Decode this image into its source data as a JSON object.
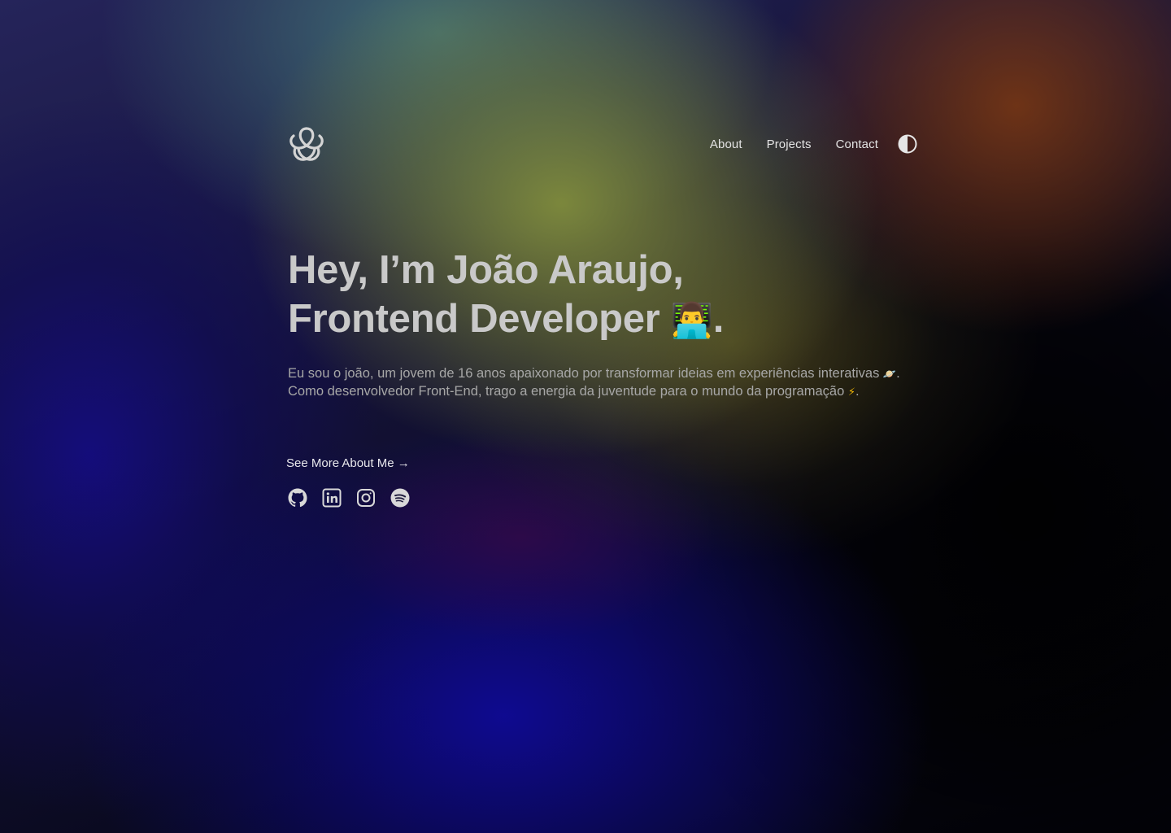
{
  "header": {
    "logo_icon": "trefoil-knot-icon",
    "nav": [
      {
        "label": "About"
      },
      {
        "label": "Projects"
      },
      {
        "label": "Contact"
      }
    ],
    "theme_toggle_icon": "contrast-half-circle-icon"
  },
  "hero": {
    "title_line1": "Hey, I’m João Araujo,",
    "title_line2_text": "Frontend Developer ",
    "title_line2_emoji": "👨‍💻",
    "title_line2_end": ".",
    "intro_part1": "Eu sou o joão, um jovem de 16 anos apaixonado por transformar ideias em experiências interativas ",
    "intro_emoji1": "🪐",
    "intro_part2": ". Como desenvolvedor Front-End, trago a energia da juventude para o mundo da programação ",
    "intro_emoji2": "⚡",
    "intro_part3": ".",
    "see_more": "See More About Me →"
  },
  "socials": [
    {
      "icon": "github-icon"
    },
    {
      "icon": "linkedin-icon"
    },
    {
      "icon": "instagram-icon"
    },
    {
      "icon": "spotify-icon"
    }
  ],
  "colors": {
    "text_primary": "#c9c9c9",
    "text_secondary": "#a7a7a7",
    "nav_text": "#e3e3e3",
    "icon": "#d8d8d8"
  }
}
